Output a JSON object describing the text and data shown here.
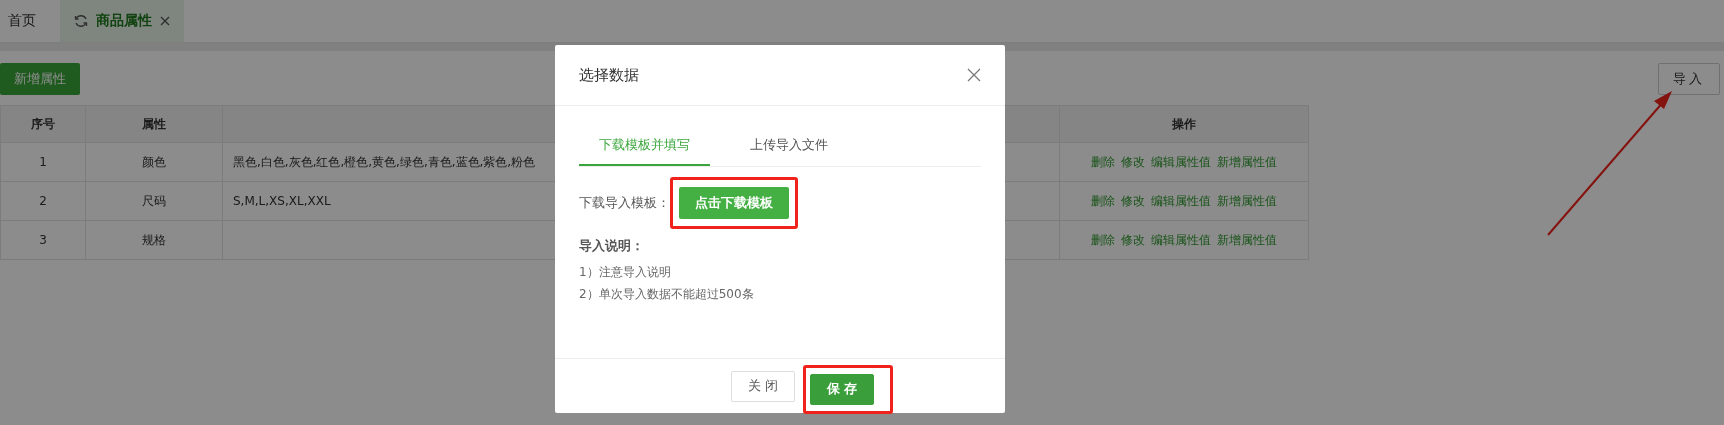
{
  "page_tabs": [
    {
      "label": "首页",
      "selected": false,
      "closable": false
    },
    {
      "label": "商品属性",
      "selected": true,
      "closable": true
    }
  ],
  "toolbar": {
    "add_button": "新增属性",
    "import_button": {
      "label": "导入",
      "annotated": true
    }
  },
  "table": {
    "columns": [
      "序号",
      "属性",
      "",
      "操作"
    ],
    "rows": [
      {
        "index": "1",
        "name": "颜色",
        "values": "黑色,白色,灰色,红色,橙色,黄色,绿色,青色,蓝色,紫色,粉色",
        "actions": [
          "删除",
          "修改",
          "编辑属性值",
          "新增属性值"
        ]
      },
      {
        "index": "2",
        "name": "尺码",
        "values": "S,M,L,XS,XL,XXL",
        "actions": [
          "删除",
          "修改",
          "编辑属性值",
          "新增属性值"
        ]
      },
      {
        "index": "3",
        "name": "规格",
        "values": "",
        "actions": [
          "删除",
          "修改",
          "编辑属性值",
          "新增属性值"
        ]
      }
    ]
  },
  "dialog": {
    "title": "选择数据",
    "tabs": [
      {
        "label": "下载模板并填写",
        "selected": true
      },
      {
        "label": "上传导入文件",
        "selected": false
      }
    ],
    "template_label": "下载导入模板：",
    "download_button": {
      "label": "点击下载模板",
      "annotated": true
    },
    "notes_title": "导入说明：",
    "notes": [
      "1）注意导入说明",
      "2）单次导入数据不能超过500条"
    ],
    "buttons": [
      {
        "label": "关 闭",
        "kind": "secondary",
        "annotated": false
      },
      {
        "label": "保 存",
        "kind": "primary",
        "annotated": true
      }
    ]
  }
}
